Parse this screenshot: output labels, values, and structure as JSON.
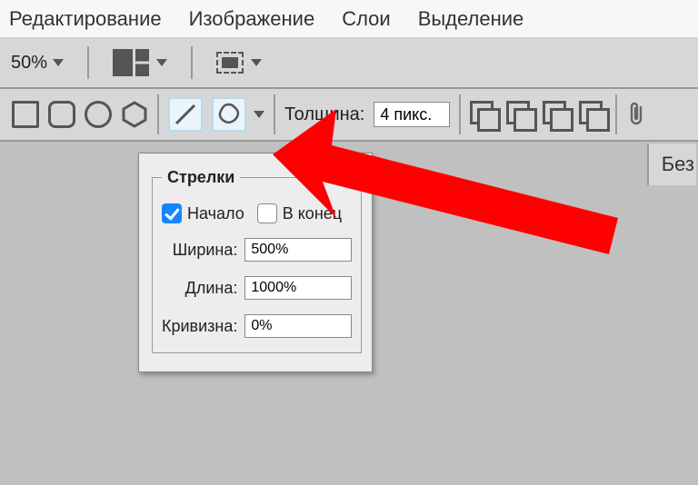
{
  "menu": {
    "edit": "Редактирование",
    "image": "Изображение",
    "layers": "Слои",
    "select": "Выделение"
  },
  "options": {
    "zoom": "50%"
  },
  "toolbar": {
    "thickness_label": "Толщина:",
    "thickness_value": "4 пикс."
  },
  "right_label": "Без",
  "popup": {
    "title": "Стрелки",
    "start_label": "Начало",
    "end_label": "В конец",
    "width_label": "Ширина:",
    "width_value": "500%",
    "length_label": "Длина:",
    "length_value": "1000%",
    "curve_label": "Кривизна:",
    "curve_value": "0%",
    "start_checked": true,
    "end_checked": false
  }
}
